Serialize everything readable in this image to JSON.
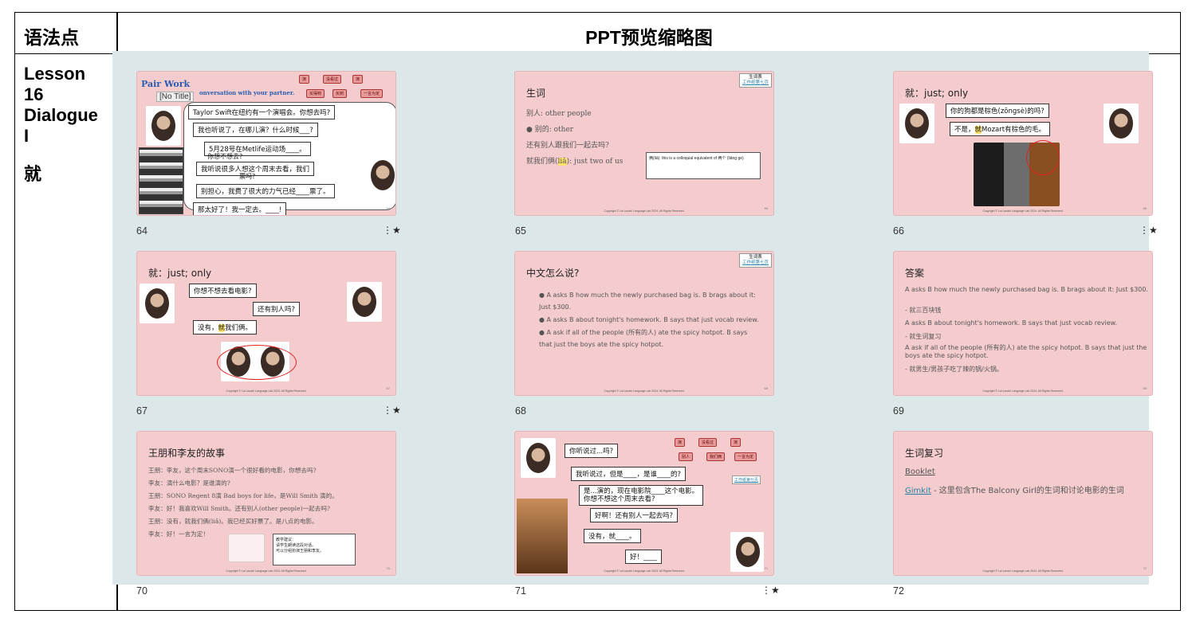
{
  "table": {
    "header_left": "语法点",
    "header_right": "PPT预览缩略图",
    "lesson": "Lesson\n16\nDialogue\nI",
    "grammar_point": "就"
  },
  "slides": [
    {
      "num": "64",
      "title": "Pair Work",
      "subtitle": "onversation with your partner.",
      "no_title": "[No Title]",
      "buttons": [
        "演",
        "没看过",
        "演",
        "买得到",
        "买到",
        "一言为定"
      ],
      "bubbles": [
        "Taylor Swift在纽约有一个演唱会。你想去吗?",
        "我也听说了，在哪儿演？什么时候___?",
        "5月28号在Metlife运动场____。",
        "你想不想去?",
        "我听说很多人想这个周末去看，我们",
        "票吗?",
        "别担心，我费了很大的力气已经____票了。",
        "那太好了！我一定去。____!"
      ],
      "slide_no": "64",
      "starred": true
    },
    {
      "num": "65",
      "title": "生词",
      "tag": [
        "生词表",
        "工作纸第七页"
      ],
      "lines": [
        "别人: other people",
        "别的: other",
        "还有别人跟我们一起去吗?",
        "就我们俩(",
        "liǎ",
        "): just two of us"
      ],
      "note": "俩(liǎ): this is a colloquial equivalent of 两个 (liǎng ge)",
      "slide_no": "65",
      "starred": false
    },
    {
      "num": "66",
      "title": "就：just; only",
      "bubbles": [
        "你的狗都是棕色(zōngsè)的吗?",
        "不是，",
        "就",
        "Mozart有棕色的毛。"
      ],
      "slide_no": "66",
      "starred": true
    },
    {
      "num": "67",
      "title": "就：just; only",
      "bubbles": [
        "你想不想去看电影?",
        "还有别人吗?",
        "没有，",
        "就",
        "我们俩。"
      ],
      "slide_no": "67",
      "starred": true
    },
    {
      "num": "68",
      "title": "中文怎么说?",
      "tag": [
        "生词表",
        "工作纸第七页"
      ],
      "bullets": [
        "A asks B how much the newly purchased bag is. B brags about it: Just $300.",
        "A asks B about tonight's homework. B says that just vocab review.",
        "A ask if all of the people (所有的人) ate the spicy hotpot. B says that just the boys ate the spicy hotpot."
      ],
      "slide_no": "68",
      "starred": false
    },
    {
      "num": "69",
      "title": "答案",
      "lines": [
        "A asks B how much the newly purchased bag is. B brags about it: Just $300.",
        "- 就三百块钱",
        "A asks B about tonight's homework. B says that just vocab review.",
        "-  就生词复习",
        "A ask if all of the people (所有的人) ate the spicy hotpot. B says that just the boys ate the spicy hotpot.",
        "- 就男生/男孩子吃了辣的锅/火锅。"
      ],
      "slide_no": "69",
      "starred": false
    },
    {
      "num": "70",
      "title": "王朋和李友的故事",
      "lines": [
        "王朋：李友，这个周末SONO演一个很好看的电影，你想去吗?",
        "李友：演什么电影？是谁演的?",
        "王朋：SONO Regent 8演 Bad boys for life，是Will Smith 演的。",
        "李友：好！我喜欢Will Smith。还有别人(other people)一起去吗?",
        "王朋：没有，就我们俩(liǎ)。我已经买好票了。是八点的电影。",
        "李友：好！一言为定！"
      ],
      "note": [
        "教学建议：",
        "请学生朗读这段对话。",
        "可以分组扮演王朋和李友。"
      ],
      "slide_no": "70",
      "starred": false
    },
    {
      "num": "71",
      "buttons": [
        "演",
        "没看过",
        "演",
        "别人",
        "我们俩",
        "一言为定"
      ],
      "tag": [
        "工作纸第七页"
      ],
      "bubbles": [
        "你听说过...吗?",
        "我听说过，但是____，是谁____的?",
        "是...演的，现在电影院____这个电影。",
        "你想不想这个周末去看?",
        "好啊！还有别人一起去吗?",
        "没有，就____。",
        "好！____"
      ],
      "slide_no": "71",
      "starred": true
    },
    {
      "num": "72",
      "title": "生词复习",
      "link1": "Booklet",
      "link2": "Gimkit",
      "text2": " - 这里包含The Balcony Girl的生词和讨论电影的生词",
      "slide_no": "72",
      "starred": false
    }
  ],
  "footer_text": "Copyright © Lai Laoshi Language Lab 2024. All Rights Reserved.",
  "star_icon": "⋮★"
}
